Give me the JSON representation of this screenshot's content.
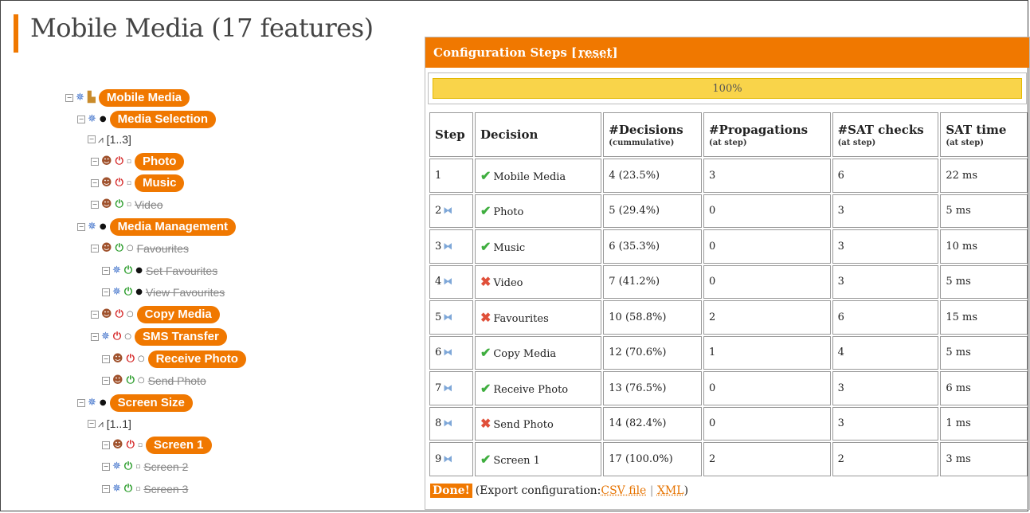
{
  "title": "Mobile Media (17 features)",
  "tree": {
    "nodes": [
      {
        "label": "Mobile Media",
        "style": "tag"
      },
      {
        "label": "Media Selection",
        "style": "tag"
      },
      {
        "label": "[1..3]",
        "style": "range"
      },
      {
        "label": "Photo",
        "style": "tag"
      },
      {
        "label": "Music",
        "style": "tag"
      },
      {
        "label": "Video",
        "style": "strike"
      },
      {
        "label": "Media Management",
        "style": "tag"
      },
      {
        "label": "Favourites",
        "style": "strike"
      },
      {
        "label": "Set Favourites",
        "style": "strike"
      },
      {
        "label": "View Favourites",
        "style": "strike"
      },
      {
        "label": "Copy Media",
        "style": "tag"
      },
      {
        "label": "SMS Transfer",
        "style": "tag"
      },
      {
        "label": "Receive Photo",
        "style": "tag"
      },
      {
        "label": "Send Photo",
        "style": "strike"
      },
      {
        "label": "Screen Size",
        "style": "tag"
      },
      {
        "label": "[1..1]",
        "style": "range"
      },
      {
        "label": "Screen 1",
        "style": "tag"
      },
      {
        "label": "Screen 2",
        "style": "strike"
      },
      {
        "label": "Screen 3",
        "style": "strike"
      }
    ]
  },
  "panel": {
    "title": "Configuration Steps",
    "reset_label": "reset",
    "progress_label": "100%",
    "progress_fraction": 1.0,
    "columns": [
      {
        "label": "Step",
        "sub": ""
      },
      {
        "label": "Decision",
        "sub": ""
      },
      {
        "label": "#Decisions",
        "sub": "(cummulative)"
      },
      {
        "label": "#Propagations",
        "sub": "(at step)"
      },
      {
        "label": "#SAT checks",
        "sub": "(at step)"
      },
      {
        "label": "SAT time",
        "sub": "(at step)"
      }
    ],
    "rows": [
      {
        "step": "1",
        "decision": "Mobile Media",
        "result": "selected",
        "decisions": "4 (23.5%)",
        "propagations": "3",
        "sat_checks": "6",
        "sat_time": "22 ms"
      },
      {
        "step": "2",
        "decision": "Photo",
        "result": "selected",
        "decisions": "5 (29.4%)",
        "propagations": "0",
        "sat_checks": "3",
        "sat_time": "5 ms"
      },
      {
        "step": "3",
        "decision": "Music",
        "result": "selected",
        "decisions": "6 (35.3%)",
        "propagations": "0",
        "sat_checks": "3",
        "sat_time": "10 ms"
      },
      {
        "step": "4",
        "decision": "Video",
        "result": "deselected",
        "decisions": "7 (41.2%)",
        "propagations": "0",
        "sat_checks": "3",
        "sat_time": "5 ms"
      },
      {
        "step": "5",
        "decision": "Favourites",
        "result": "deselected",
        "decisions": "10 (58.8%)",
        "propagations": "2",
        "sat_checks": "6",
        "sat_time": "15 ms"
      },
      {
        "step": "6",
        "decision": "Copy Media",
        "result": "selected",
        "decisions": "12 (70.6%)",
        "propagations": "1",
        "sat_checks": "4",
        "sat_time": "5 ms"
      },
      {
        "step": "7",
        "decision": "Receive Photo",
        "result": "selected",
        "decisions": "13 (76.5%)",
        "propagations": "0",
        "sat_checks": "3",
        "sat_time": "6 ms"
      },
      {
        "step": "8",
        "decision": "Send Photo",
        "result": "deselected",
        "decisions": "14 (82.4%)",
        "propagations": "0",
        "sat_checks": "3",
        "sat_time": "1 ms"
      },
      {
        "step": "9",
        "decision": "Screen 1",
        "result": "selected",
        "decisions": "17 (100.0%)",
        "propagations": "2",
        "sat_checks": "2",
        "sat_time": "3 ms"
      }
    ],
    "footer": {
      "done_label": "Done!",
      "export_prefix": "(Export configuration: ",
      "csv_label": "CSV file",
      "separator": " | ",
      "xml_label": "XML",
      "suffix": ")"
    }
  },
  "colors": {
    "accent": "#f07800",
    "progress": "#f9d44a",
    "check": "#3fae3f",
    "cross": "#e0503a"
  }
}
